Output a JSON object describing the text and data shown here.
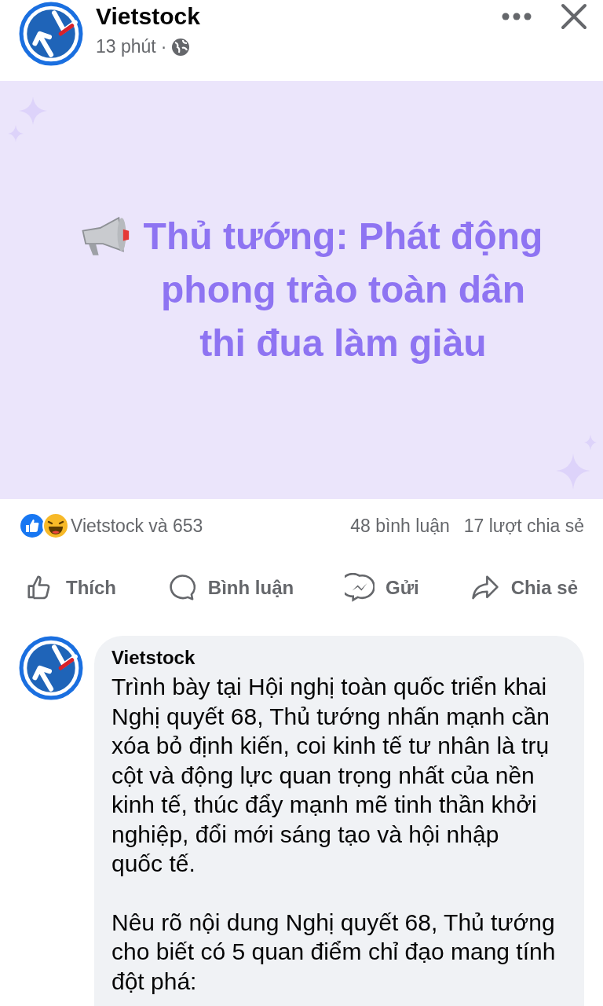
{
  "post": {
    "author": "Vietstock",
    "time": "13 phút",
    "separator": "·"
  },
  "banner": {
    "title": "Thủ tướng: Phát động phong trào toàn dân thi đua làm giàu"
  },
  "stats": {
    "reactions": "Vietstock và 653",
    "comments": "48 bình luận",
    "shares": "17 lượt chia sẻ"
  },
  "actions": [
    {
      "kind": "like",
      "label": "Thích"
    },
    {
      "kind": "comment",
      "label": "Bình luận"
    },
    {
      "kind": "send",
      "label": "Gửi"
    },
    {
      "kind": "share",
      "label": "Chia sẻ"
    }
  ],
  "comment": {
    "author": "Vietstock",
    "paragraphs": [
      "Trình bày tại Hội nghị toàn quốc triển khai Nghị quyết 68, Thủ tướng nhấn mạnh cần xóa bỏ định kiến, coi kinh tế tư nhân là trụ cột và động lực quan trọng nhất của nền kinh tế, thúc đẩy mạnh mẽ tinh thần khởi nghiệp, đổi mới sáng tạo và hội nhập quốc tế.",
      "Nêu rõ nội dung Nghị quyết 68, Thủ tướng cho biết có 5 quan điểm chỉ đạo mang tính đột phá:"
    ]
  }
}
